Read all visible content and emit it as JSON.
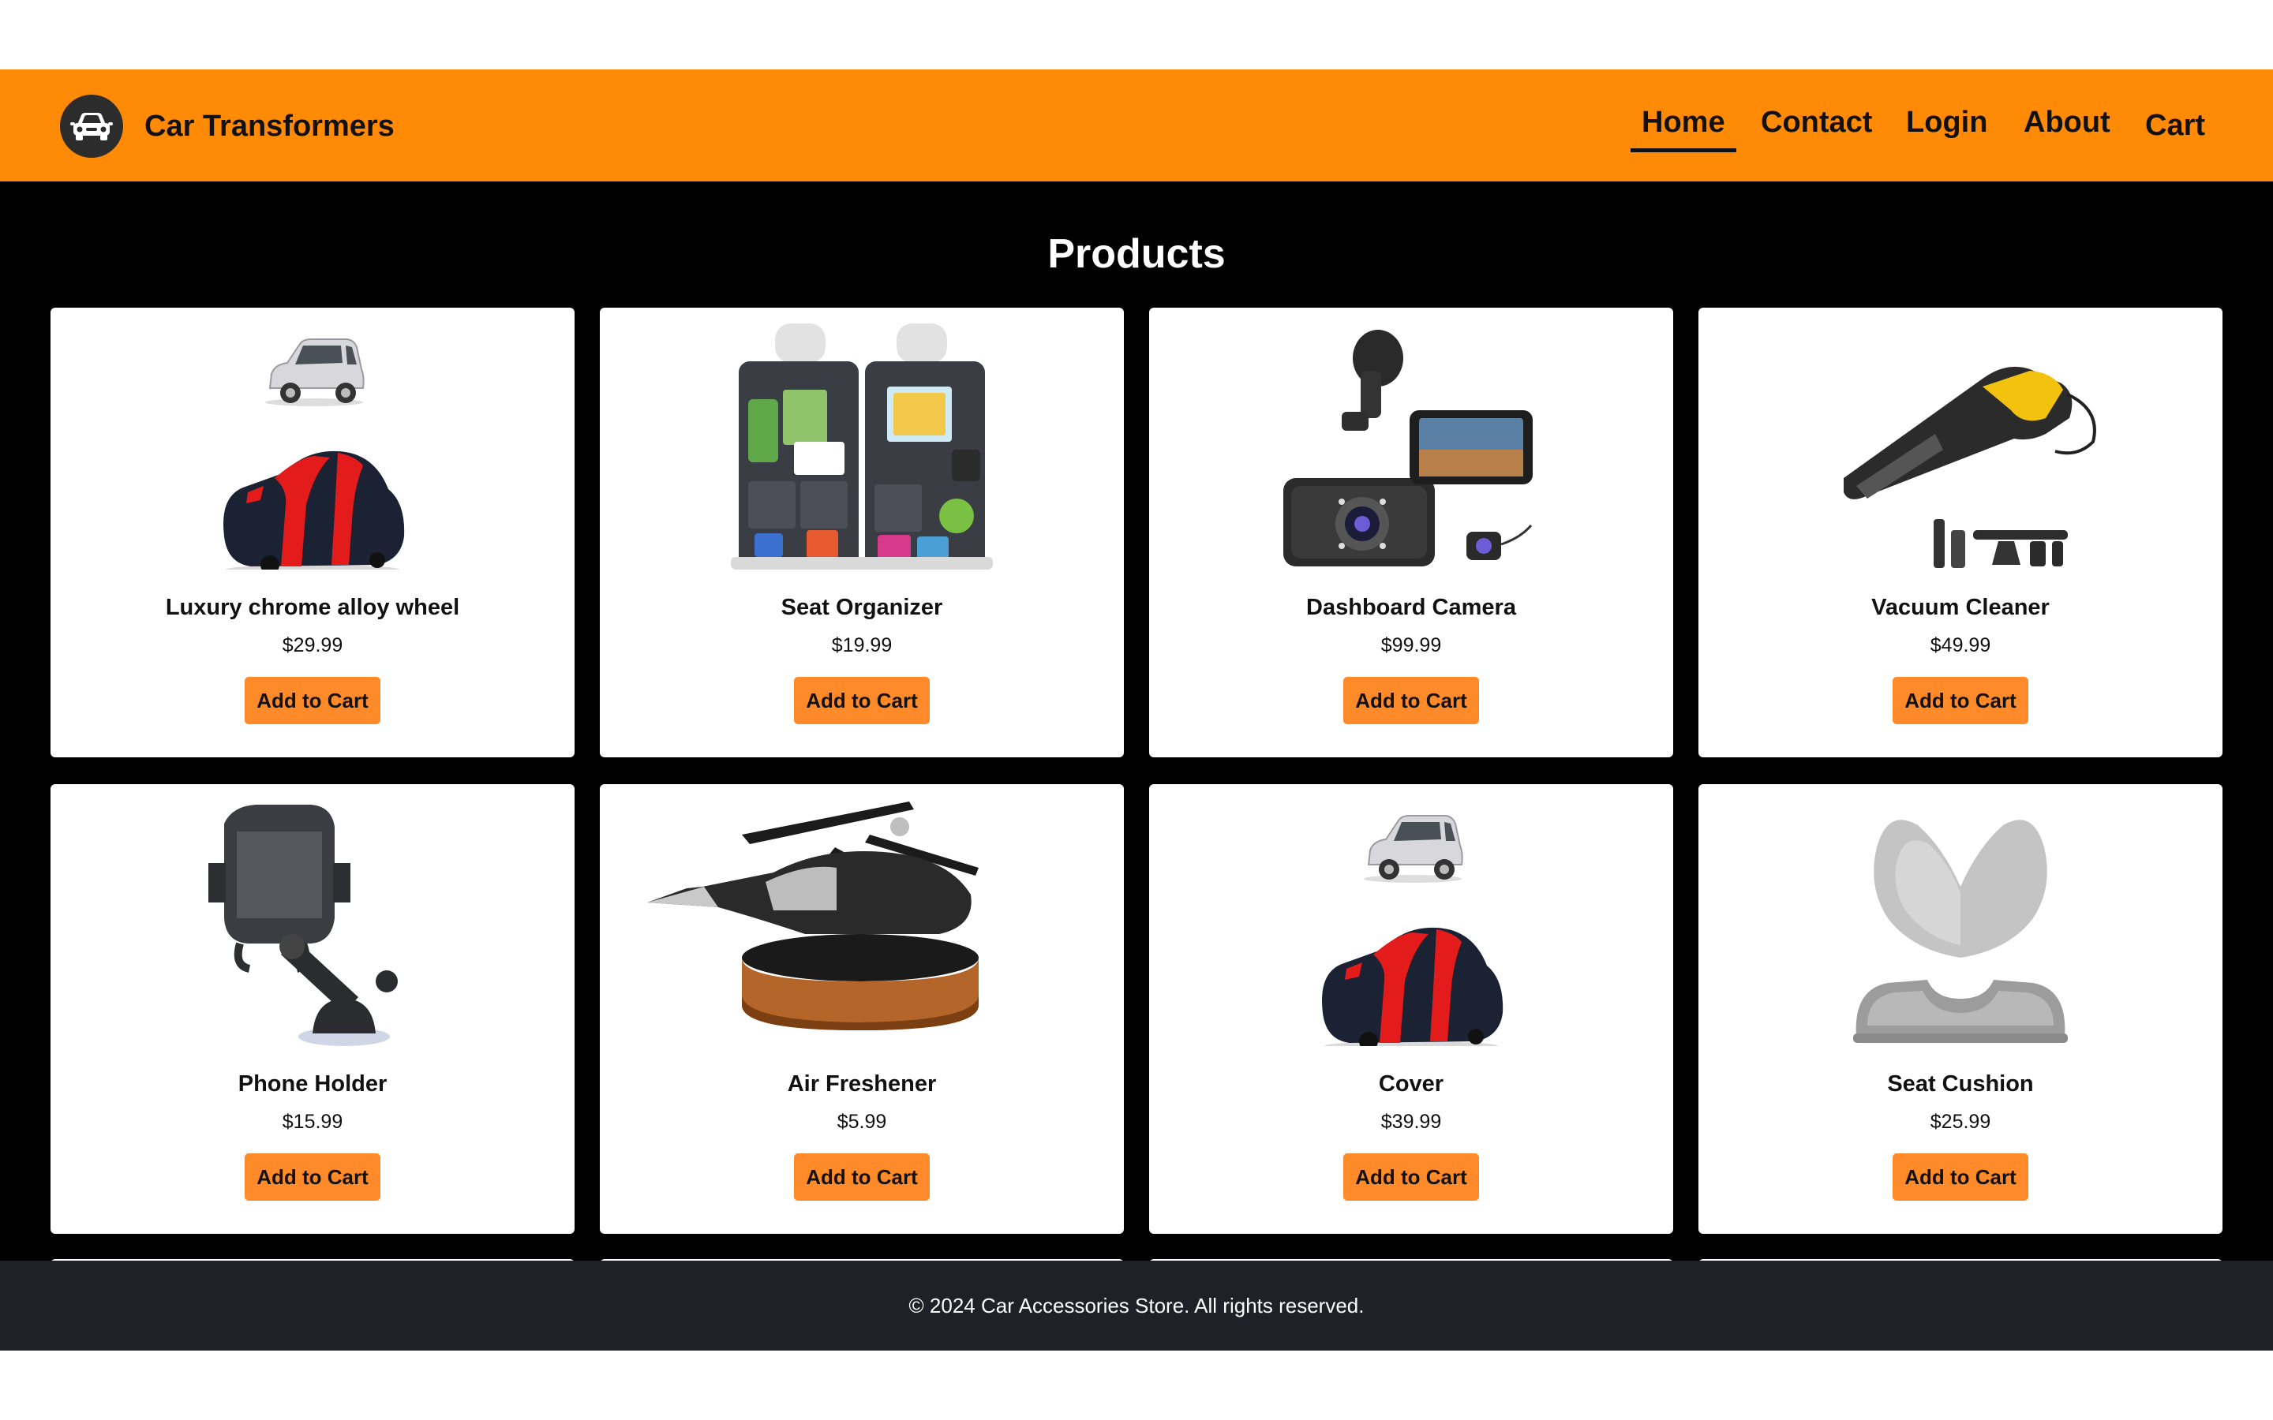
{
  "header": {
    "brand_name": "Car Transformers",
    "logo_icon": "car-front-icon",
    "nav": [
      {
        "label": "Home",
        "active": true
      },
      {
        "label": "Contact",
        "active": false
      },
      {
        "label": "Login",
        "active": false
      },
      {
        "label": "About",
        "active": false
      },
      {
        "label": "Cart",
        "active": false
      }
    ]
  },
  "main": {
    "title": "Products",
    "products": [
      {
        "name": "Luxury chrome alloy wheel",
        "price": "$29.99",
        "button": "Add to Cart",
        "image": "car-cover-image"
      },
      {
        "name": "Seat Organizer",
        "price": "$19.99",
        "button": "Add to Cart",
        "image": "seat-organizer-image"
      },
      {
        "name": "Dashboard Camera",
        "price": "$99.99",
        "button": "Add to Cart",
        "image": "dashboard-camera-image"
      },
      {
        "name": "Vacuum Cleaner",
        "price": "$49.99",
        "button": "Add to Cart",
        "image": "vacuum-cleaner-image"
      },
      {
        "name": "Phone Holder",
        "price": "$15.99",
        "button": "Add to Cart",
        "image": "phone-holder-image"
      },
      {
        "name": "Air Freshener",
        "price": "$5.99",
        "button": "Add to Cart",
        "image": "air-freshener-image"
      },
      {
        "name": "Cover",
        "price": "$39.99",
        "button": "Add to Cart",
        "image": "car-cover-image"
      },
      {
        "name": "Seat Cushion",
        "price": "$25.99",
        "button": "Add to Cart",
        "image": "seat-cushion-image"
      }
    ]
  },
  "footer": {
    "text": "© 2024 Car Accessories Store. All rights reserved."
  },
  "colors": {
    "header_bg": "#ff8a05",
    "main_bg": "#000000",
    "button_bg": "#ff8a2a",
    "footer_bg": "#1f2129"
  }
}
